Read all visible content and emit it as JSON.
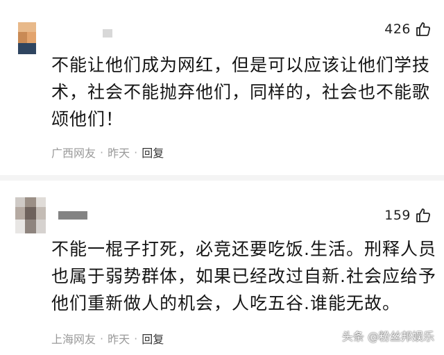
{
  "comments": [
    {
      "like_count": "426",
      "content_lines": [
        "不能让他们成为网红，但是可以应该让他们学技",
        "术，社会不能抛弃他们，同样的，社会也不能歌",
        "颂他们！"
      ],
      "location": "广西网友",
      "time": "昨天",
      "reply_label": "回复"
    },
    {
      "like_count": "159",
      "content_lines": [
        "不能一棍子打死，必竞还要吃饭.生活。刑释人员",
        "也属于弱势群体，如果已经改过自新.社会应给予",
        "他们重新做人的机会，人吃五谷.谁能无故。"
      ],
      "location": "上海网友",
      "time": "昨天",
      "reply_label": "回复"
    }
  ],
  "separator": "·",
  "watermark": "头条 @粉丝邦娱乐",
  "colors": {
    "text": "#151515",
    "meta": "#999999",
    "divider": "#f4f4f4"
  },
  "icons": {
    "like": "thumbs-up-icon",
    "avatar": "blurred-avatar"
  }
}
